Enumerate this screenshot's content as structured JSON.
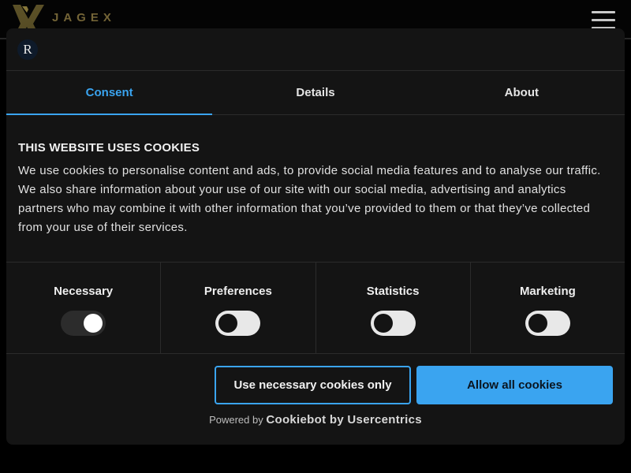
{
  "site": {
    "logo_text": "JAGEX"
  },
  "dialog": {
    "brand_mark": "R",
    "tabs": [
      {
        "label": "Consent",
        "active": true
      },
      {
        "label": "Details",
        "active": false
      },
      {
        "label": "About",
        "active": false
      }
    ],
    "heading": "THIS WEBSITE USES COOKIES",
    "body_text": "We use cookies to personalise content and ads, to provide social media features and to analyse our traffic. We also share information about your use of our site with our social media, advertising and analytics partners who may combine it with other information that you’ve provided to them or that they’ve collected from your use of their services.",
    "categories": [
      {
        "label": "Necessary",
        "enabled": true
      },
      {
        "label": "Preferences",
        "enabled": false
      },
      {
        "label": "Statistics",
        "enabled": false
      },
      {
        "label": "Marketing",
        "enabled": false
      }
    ],
    "buttons": {
      "necessary_only": "Use necessary cookies only",
      "allow_all": "Allow all cookies"
    },
    "powered_by": {
      "prefix": "Powered by",
      "brand": "Cookiebot by Usercentrics"
    }
  },
  "colors": {
    "accent": "#3aa4f0",
    "dialog_bg": "#141414",
    "page_bg": "#000000"
  }
}
